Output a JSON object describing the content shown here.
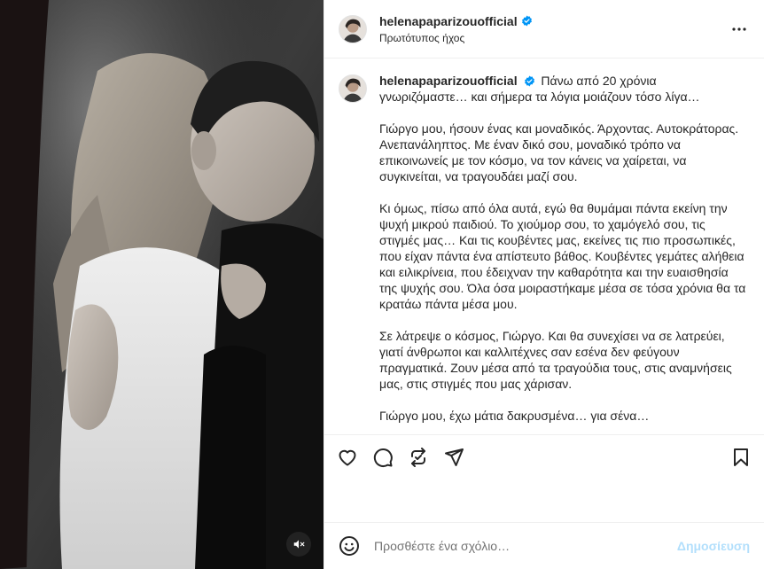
{
  "colors": {
    "accent": "#0095f6",
    "post_disabled": "#b2dffc",
    "text": "#262626",
    "secondary_text": "#737373",
    "verified": "#0095f6"
  },
  "media": {
    "mute_icon": "speaker-muted-icon"
  },
  "header": {
    "username": "helenapaparizouofficial",
    "audio_label": "Πρωτότυπος ήχος",
    "more_icon": "more-options-icon"
  },
  "caption": {
    "username": "helenapaparizouofficial",
    "first_line": "Πάνω από 20 χρόνια γνωριζόμαστε… και σήμερα τα λόγια μοιάζουν τόσο λίγα…",
    "paragraphs": [
      "Γιώργο μου, ήσουν ένας και μοναδικός. Άρχοντας. Αυτοκράτορας. Ανεπανάληπτος. Με έναν δικό σου, μοναδικό τρόπο να επικοινωνείς με τον κόσμο, να τον κάνεις να χαίρεται, να συγκινείται, να τραγουδάει μαζί σου.",
      "Κι όμως, πίσω από όλα αυτά, εγώ θα θυμάμαι πάντα εκείνη την ψυχή μικρού παιδιού. Το χιούμορ σου, το χαμόγελό σου, τις στιγμές μας… Και τις κουβέντες μας, εκείνες τις πιο προσωπικές, που είχαν πάντα ένα απίστευτο βάθος. Κουβέντες γεμάτες αλήθεια και ειλικρίνεια, που έδειχναν την καθαρότητα και την ευαισθησία της ψυχής σου. Όλα όσα μοιραστήκαμε μέσα σε τόσα χρόνια θα τα κρατάω πάντα μέσα μου.",
      "Σε λάτρεψε ο κόσμος, Γιώργο. Και θα συνεχίσει να σε λατρεύει, γιατί άνθρωποι και καλλιτέχνες σαν εσένα δεν φεύγουν πραγματικά. Ζουν μέσα από τα τραγούδια τους, στις αναμνήσεις μας, στις στιγμές που μας χάρισαν.",
      "Γιώργο μου, έχω μάτια δακρυσμένα… για σένα…"
    ]
  },
  "actions": {
    "like_icon": "heart-icon",
    "comment_icon": "comment-icon",
    "repost_icon": "repost-icon",
    "share_icon": "paper-plane-icon",
    "save_icon": "bookmark-icon"
  },
  "comment_box": {
    "emoji_icon": "emoji-icon",
    "placeholder": "Προσθέστε ένα σχόλιο…",
    "post_label": "Δημοσίευση"
  }
}
